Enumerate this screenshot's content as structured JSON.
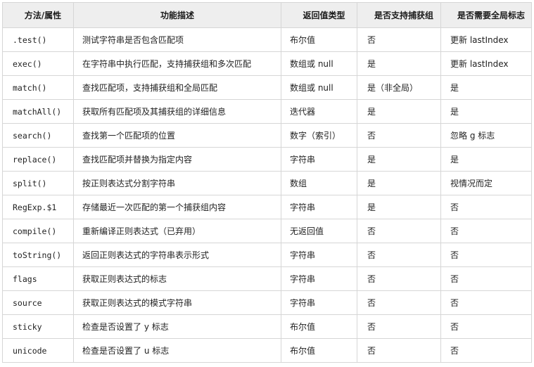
{
  "table": {
    "headers": [
      "方法/属性",
      "功能描述",
      "返回值类型",
      "是否支持捕获组",
      "是否需要全局标志"
    ],
    "rows": [
      {
        "method": ".test()",
        "desc": "测试字符串是否包含匹配项",
        "ret": "布尔值",
        "capture": "否",
        "global": "更新 lastIndex"
      },
      {
        "method": "exec()",
        "desc": "在字符串中执行匹配，支持捕获组和多次匹配",
        "ret": "数组或 null",
        "capture": "是",
        "global": "更新 lastIndex"
      },
      {
        "method": "match()",
        "desc": "查找匹配项，支持捕获组和全局匹配",
        "ret": "数组或 null",
        "capture": "是（非全局）",
        "global": "是"
      },
      {
        "method": "matchAll()",
        "desc": "获取所有匹配项及其捕获组的详细信息",
        "ret": "迭代器",
        "capture": "是",
        "global": "是"
      },
      {
        "method": "search()",
        "desc": "查找第一个匹配项的位置",
        "ret": "数字（索引）",
        "capture": "否",
        "global": "忽略 g 标志"
      },
      {
        "method": "replace()",
        "desc": "查找匹配项并替换为指定内容",
        "ret": "字符串",
        "capture": "是",
        "global": "是"
      },
      {
        "method": "split()",
        "desc": "按正则表达式分割字符串",
        "ret": "数组",
        "capture": "是",
        "global": "视情况而定"
      },
      {
        "method": "RegExp.$1",
        "desc": "存储最近一次匹配的第一个捕获组内容",
        "ret": "字符串",
        "capture": "是",
        "global": "否"
      },
      {
        "method": "compile()",
        "desc": "重新编译正则表达式（已弃用）",
        "ret": "无返回值",
        "capture": "否",
        "global": "否"
      },
      {
        "method": "toString()",
        "desc": "返回正则表达式的字符串表示形式",
        "ret": "字符串",
        "capture": "否",
        "global": "否"
      },
      {
        "method": "flags",
        "desc": "获取正则表达式的标志",
        "ret": "字符串",
        "capture": "否",
        "global": "否"
      },
      {
        "method": "source",
        "desc": "获取正则表达式的模式字符串",
        "ret": "字符串",
        "capture": "否",
        "global": "否"
      },
      {
        "method": "sticky",
        "desc": "检查是否设置了 y 标志",
        "ret": "布尔值",
        "capture": "否",
        "global": "否"
      },
      {
        "method": "unicode",
        "desc": "检查是否设置了 u 标志",
        "ret": "布尔值",
        "capture": "否",
        "global": "否"
      }
    ]
  }
}
